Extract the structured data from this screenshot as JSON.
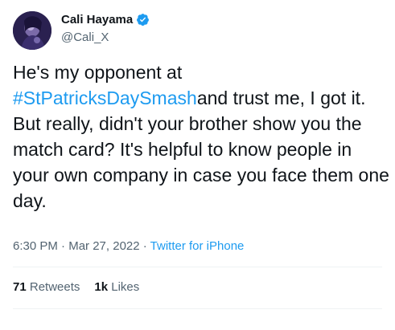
{
  "author": {
    "name": "Cali Hayama",
    "handle": "@Cali_X",
    "verified_icon": "verified-badge-icon"
  },
  "tweet": {
    "text_before": "He's my opponent at ",
    "hashtag": "#StPatricksDaySmash",
    "text_after": "and trust me, I got it. But really, didn't your brother show you the match card? It's helpful to know people in your own company in case you face them one day."
  },
  "meta": {
    "time": "6:30 PM",
    "separator_1": " · ",
    "date": "Mar 27, 2022",
    "separator_2": " · ",
    "source": "Twitter for iPhone"
  },
  "stats": {
    "retweets_count": "71",
    "retweets_label": "Retweets",
    "likes_count": "1k",
    "likes_label": "Likes"
  },
  "colors": {
    "accent": "#1d9bf0",
    "text": "#0f1419",
    "secondary": "#536471",
    "divider": "#eff3f4"
  }
}
